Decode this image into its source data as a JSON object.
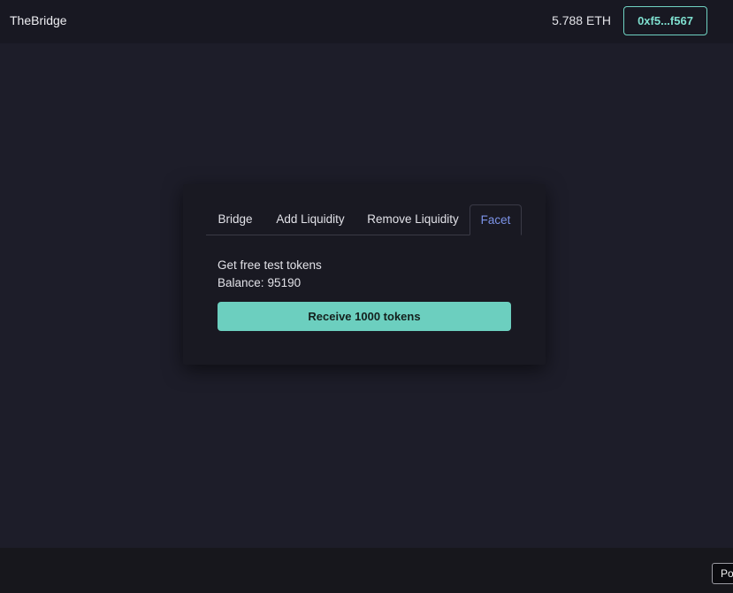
{
  "navbar": {
    "brand": "TheBridge",
    "eth_balance": "5.788 ETH",
    "wallet_label": "0xf5...f567"
  },
  "tabs": [
    {
      "label": "Bridge",
      "active": false
    },
    {
      "label": "Add Liquidity",
      "active": false
    },
    {
      "label": "Remove Liquidity",
      "active": false
    },
    {
      "label": "Facet",
      "active": true
    }
  ],
  "facet": {
    "title": "Get free test tokens",
    "balance_label": "Balance:",
    "balance_value": "95190",
    "button_label": "Receive 1000 tokens"
  },
  "footer": {
    "button_label": "Po"
  },
  "colors": {
    "background": "#1d1d29",
    "navbar": "#181822",
    "card": "#191922",
    "accent": "#6ccfbf",
    "active_tab": "#7c93e8"
  }
}
